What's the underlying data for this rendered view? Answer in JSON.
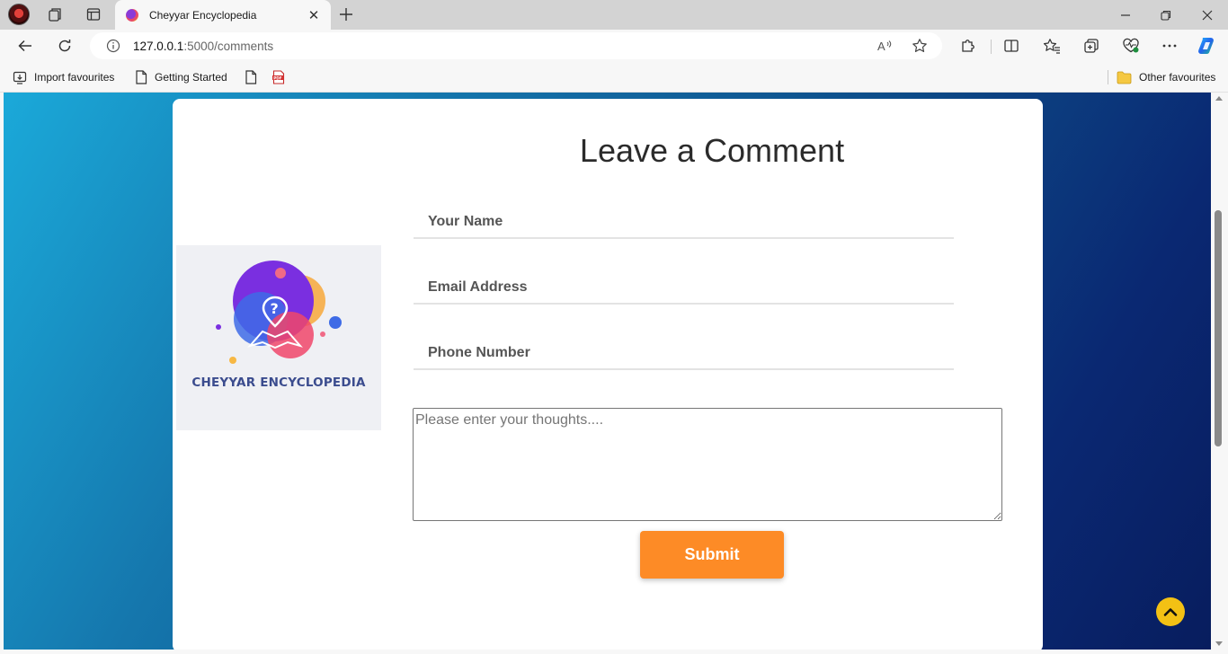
{
  "browser": {
    "tab_title": "Cheyyar Encyclopedia",
    "url_host": "127.0.0.1",
    "url_path": ":5000/comments",
    "favourites": [
      {
        "label": "Import favourites"
      },
      {
        "label": "Getting Started"
      }
    ],
    "other_favourites": "Other favourites"
  },
  "page": {
    "heading": "Leave a Comment",
    "logo_text": "CHEYYAR ENCYCLOPEDIA",
    "name_placeholder": "Your Name",
    "email_placeholder": "Email Address",
    "phone_placeholder": "Phone Number",
    "thoughts_placeholder": "Please enter your thoughts....",
    "submit_label": "Submit"
  },
  "colors": {
    "submit": "#fd8b26",
    "back_to_top": "#f3c114",
    "gradient_start": "#1ba9d9",
    "gradient_end": "#081d5e"
  },
  "icons": [
    "profile-avatar",
    "workspaces-icon",
    "tab-actions-icon",
    "close-icon",
    "plus-icon",
    "minimize-icon",
    "restore-icon",
    "back-icon",
    "refresh-icon",
    "info-icon",
    "read-aloud-icon",
    "star-icon",
    "extensions-icon",
    "split-screen-icon",
    "favourites-icon",
    "collections-icon",
    "browser-essentials-icon",
    "more-icon",
    "copilot-icon",
    "import-icon",
    "page-icon",
    "pdf-icon",
    "folder-icon",
    "chevron-up-icon"
  ]
}
